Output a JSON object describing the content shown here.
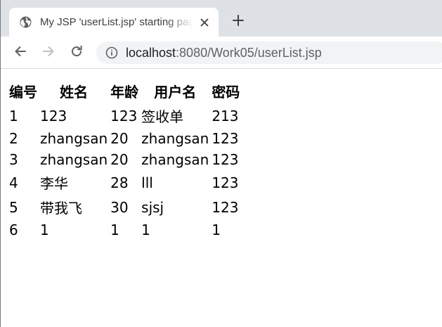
{
  "browser": {
    "tab": {
      "title": "My JSP 'userList.jsp' starting page",
      "favicon": "globe-icon",
      "close_icon": "close-icon"
    },
    "new_tab_icon": "plus-icon",
    "toolbar": {
      "back_icon": "arrow-left-icon",
      "forward_icon": "arrow-right-icon",
      "reload_icon": "reload-icon",
      "info_icon": "info-icon"
    },
    "address": {
      "host": "localhost",
      "rest": ":8080/Work05/userList.jsp"
    }
  },
  "table": {
    "headers": [
      "编号",
      "姓名",
      "年龄",
      "用户名",
      "密码"
    ],
    "rows": [
      [
        "1",
        "123",
        "123",
        "签收单",
        "213"
      ],
      [
        "2",
        "zhangsan",
        "20",
        "zhangsan",
        "123"
      ],
      [
        "3",
        "zhangsan",
        "20",
        "zhangsan",
        "123"
      ],
      [
        "4",
        "李华",
        "28",
        "lll",
        "123"
      ],
      [
        "5",
        "带我飞",
        "30",
        "sjsj",
        "123"
      ],
      [
        "6",
        "1",
        "1",
        "1",
        "1"
      ]
    ]
  },
  "colors": {
    "tabstrip": "#dee1e6",
    "omnibox": "#f1f3f4",
    "icon": "#5f6368",
    "icon_disabled": "#bdc1c6",
    "text": "#000000"
  }
}
